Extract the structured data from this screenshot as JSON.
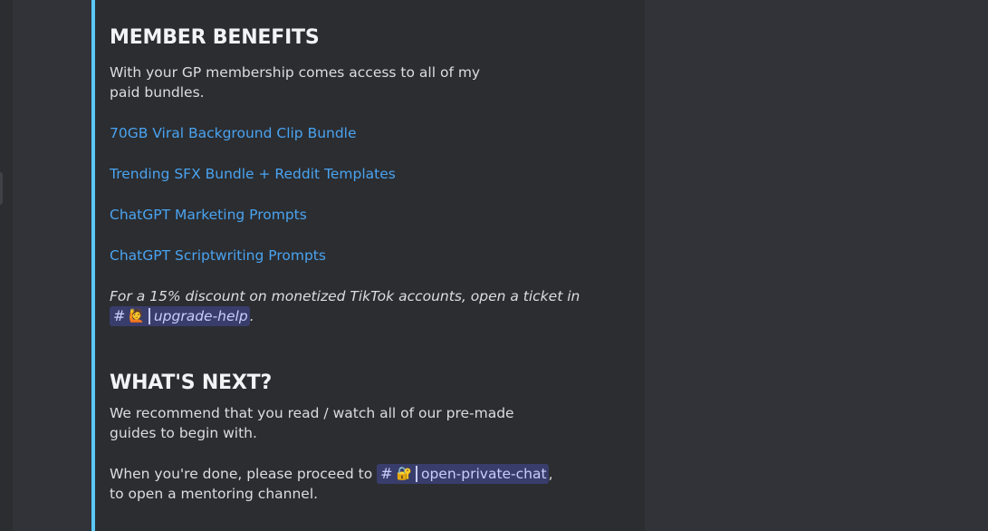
{
  "benefits": {
    "heading": "MEMBER BENEFITS",
    "intro": "With your GP membership comes access to all of my paid bundles.",
    "links": [
      "70GB Viral Background Clip Bundle",
      "Trending SFX Bundle + Reddit Templates",
      "ChatGPT Marketing Prompts",
      "ChatGPT Scriptwriting Prompts"
    ],
    "discount_text": "For a 15% discount on monetized TikTok accounts, open a ticket in",
    "discount_channel": {
      "hash": "#",
      "emoji": "🙋",
      "name": "upgrade-help"
    },
    "discount_end": "."
  },
  "next": {
    "heading": "WHAT'S NEXT?",
    "intro": "We recommend that you read / watch all of our pre-made guides to begin with.",
    "proceed_text": "When you're done, please proceed to",
    "proceed_channel": {
      "hash": "#",
      "emoji": "🔐",
      "name": "open-private-chat"
    },
    "proceed_end": ",",
    "proceed_after": "to open a mentoring channel."
  },
  "colors": {
    "accent_bar": "#5bc8f5",
    "link": "#4aa3f0",
    "mention_bg": "#3c4270",
    "background": "#313338",
    "embed_bg": "#2b2d31"
  }
}
